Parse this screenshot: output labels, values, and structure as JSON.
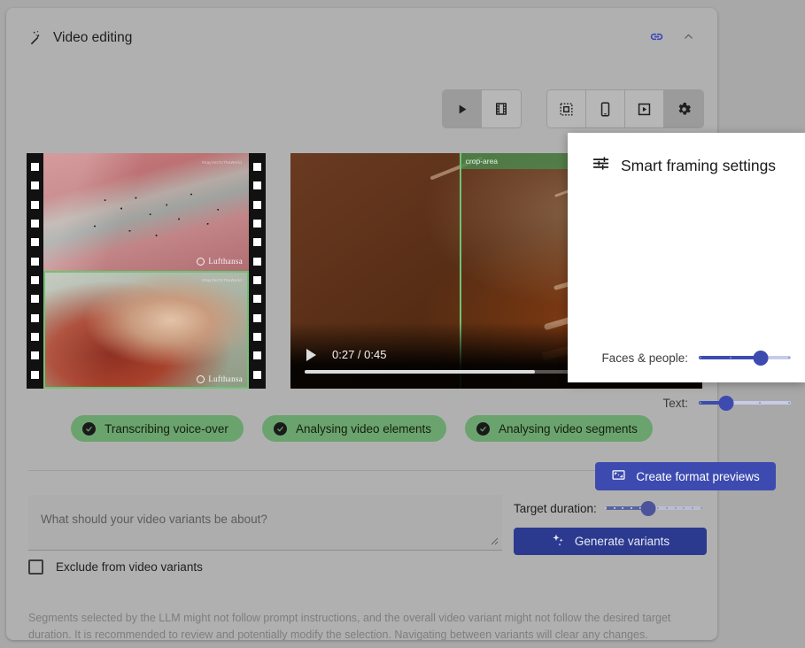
{
  "header": {
    "title": "Video editing",
    "wand_icon": "magic-wand-icon",
    "link_icon": "link-icon",
    "collapse_icon": "chevron-up-icon"
  },
  "toolbar": {
    "group_playback": [
      {
        "icon": "play-icon",
        "name": "play-view-button",
        "selected": true
      },
      {
        "icon": "filmstrip-icon",
        "name": "filmstrip-view-button",
        "selected": false
      }
    ],
    "group_format": [
      {
        "icon": "crop-select-icon",
        "name": "crop-format-button",
        "selected": false
      },
      {
        "icon": "smartphone-icon",
        "name": "mobile-format-button",
        "selected": false
      },
      {
        "icon": "video-box-icon",
        "name": "video-format-button",
        "selected": false
      },
      {
        "icon": "gear-icon",
        "name": "settings-button",
        "selected": true
      }
    ]
  },
  "filmstrip": {
    "thumbnails": [
      {
        "watermark": "Lufthansa",
        "selected": false
      },
      {
        "watermark": "Lufthansa",
        "selected": true
      }
    ]
  },
  "player": {
    "crop_label": "crop-area",
    "play_icon": "play-icon",
    "timestamp": "0:27 / 0:45",
    "current_time": "0:27",
    "duration": "0:45",
    "progress_percent": 60
  },
  "status_chips": [
    {
      "label": "Transcribing voice-over",
      "icon": "check-circle-icon",
      "color": "#6ba36e"
    },
    {
      "label": "Analysing video elements",
      "icon": "check-circle-icon",
      "color": "#6ba36e"
    },
    {
      "label": "Analysing video segments",
      "icon": "check-circle-icon",
      "color": "#6ba36e"
    }
  ],
  "form": {
    "prompt_placeholder": "What should your video variants be about?",
    "prompt_value": "",
    "exclude_checkbox_label": "Exclude from video variants",
    "exclude_checked": false,
    "target_duration_label": "Target duration:",
    "target_duration_percent": 45,
    "generate_button_label": "Generate variants",
    "generate_button_icon": "sparkles-icon",
    "generate_button_color": "#2b3a8f"
  },
  "popup": {
    "title": "Smart framing settings",
    "title_icon": "tune-icon",
    "sliders": [
      {
        "label": "Faces & people:",
        "percent": 67,
        "name": "faces-and-people-slider"
      },
      {
        "label": "Text:",
        "percent": 30,
        "name": "text-slider"
      }
    ],
    "button_label": "Create format previews",
    "button_icon": "aspect-ratio-icon",
    "button_color": "#3d4bb0"
  },
  "footer": {
    "disclaimer": "Segments selected by the LLM might not follow prompt instructions, and the overall video variant might not follow the desired target duration. It is recommended to review and potentially modify the selection. Navigating between variants will clear any changes."
  }
}
